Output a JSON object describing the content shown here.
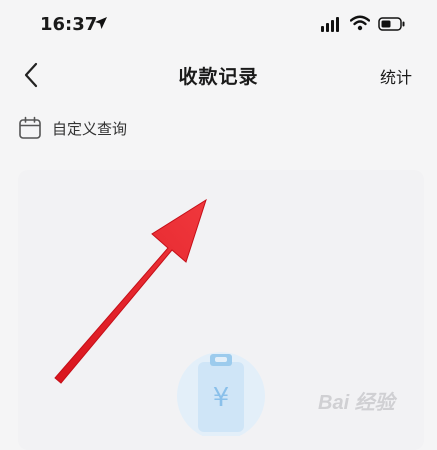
{
  "status_bar": {
    "time": "16:37",
    "icons": [
      "location-arrow-icon",
      "signal-icon",
      "wifi-icon",
      "battery-icon"
    ]
  },
  "nav": {
    "title": "收款记录",
    "action_label": "统计",
    "back_icon": "chevron-left-icon"
  },
  "filter": {
    "label": "自定义查询",
    "icon": "calendar-icon"
  },
  "empty_state": {
    "icon": "clipboard-yen-icon",
    "symbol": "¥"
  },
  "watermark": {
    "brand": "Bai 经验",
    "icon": "paw-icon"
  },
  "colors": {
    "background": "#f5f5f6",
    "card": "#f2f2f4",
    "arrow": "#e8232a",
    "illustration_blue": "#a9d3f2"
  }
}
